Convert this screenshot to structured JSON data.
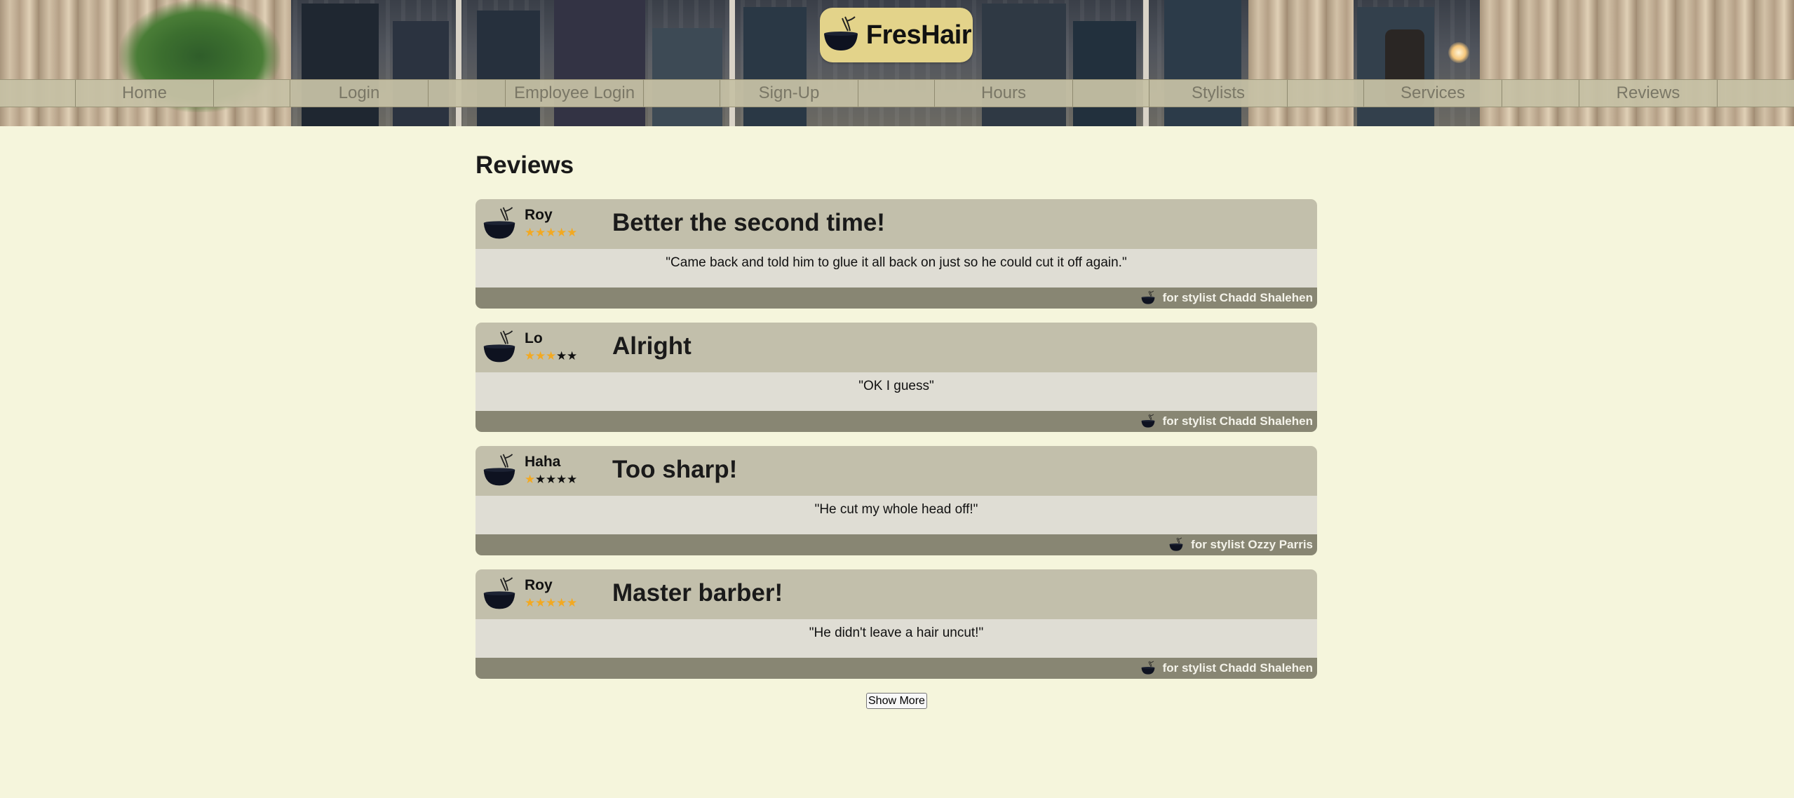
{
  "brand": {
    "name": "FresHair",
    "logo_icon": "bowl-icon"
  },
  "nav": [
    {
      "label": "Home",
      "name": "nav-home"
    },
    {
      "label": "Login",
      "name": "nav-login"
    },
    {
      "label": "Employee Login",
      "name": "nav-employee-login"
    },
    {
      "label": "Sign-Up",
      "name": "nav-sign-up"
    },
    {
      "label": "Hours",
      "name": "nav-hours"
    },
    {
      "label": "Stylists",
      "name": "nav-stylists"
    },
    {
      "label": "Services",
      "name": "nav-services"
    },
    {
      "label": "Reviews",
      "name": "nav-reviews"
    }
  ],
  "page": {
    "title": "Reviews"
  },
  "reviews": [
    {
      "author": "Roy",
      "rating": 5,
      "max_rating": 5,
      "title": "Better the second time!",
      "text": "\"Came back and told him to glue it all back on just so he could cut it off again.\"",
      "stylist": "for stylist Chadd Shalehen"
    },
    {
      "author": "Lo",
      "rating": 3,
      "max_rating": 5,
      "title": "Alright",
      "text": "\"OK I guess\"",
      "stylist": "for stylist Chadd Shalehen"
    },
    {
      "author": "Haha",
      "rating": 1,
      "max_rating": 5,
      "title": "Too sharp!",
      "text": "\"He cut my whole head off!\"",
      "stylist": "for stylist Ozzy Parris"
    },
    {
      "author": "Roy",
      "rating": 5,
      "max_rating": 5,
      "title": "Master barber!",
      "text": "\"He didn't leave a hair uncut!\"",
      "stylist": "for stylist Chadd Shalehen"
    }
  ],
  "actions": {
    "show_more_label": "Show More"
  },
  "colors": {
    "background": "#f5f5dc",
    "accent": "#e3d38a",
    "star_on": "#f2a922",
    "star_off": "#111111",
    "card_head": "#c2bfab",
    "card_foot": "#888673"
  }
}
